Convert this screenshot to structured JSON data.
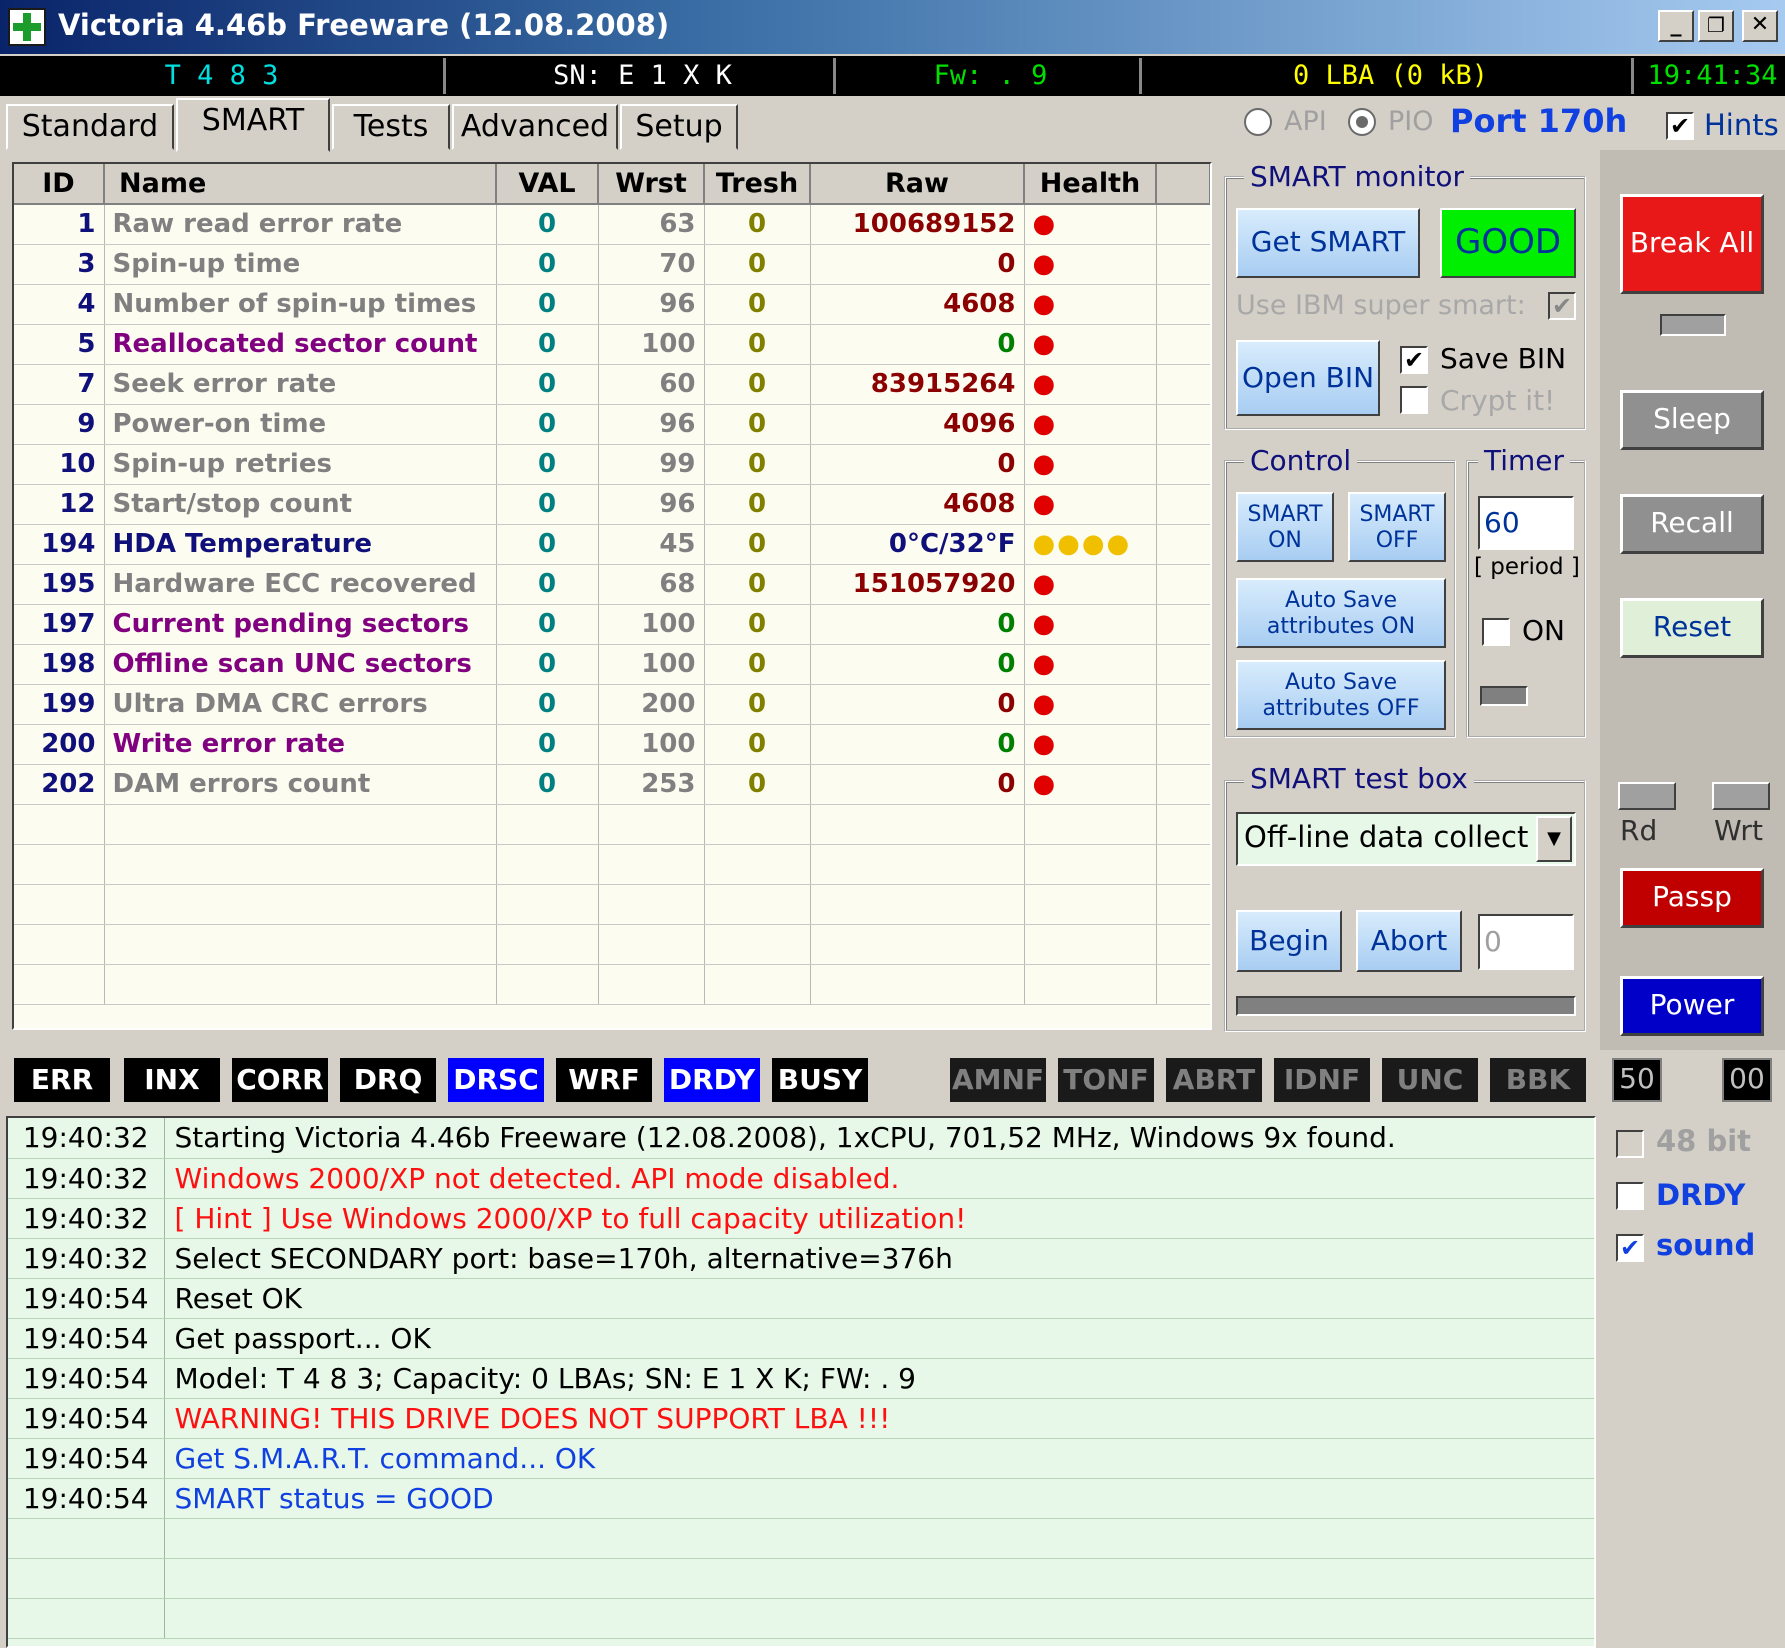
{
  "window": {
    "title": "Victoria 4.46b Freeware (12.08.2008)",
    "controls": {
      "minimize": "_",
      "restore": "❐",
      "close": "✕"
    }
  },
  "status": {
    "model": "T 4 8 3",
    "serial": "SN: E 1 X K",
    "firmware": "Fw: . 9",
    "lba": "0 LBA (0 kB)",
    "clock": "19:41:34"
  },
  "tabs": [
    {
      "label": "Standard"
    },
    {
      "label": "SMART"
    },
    {
      "label": "Tests"
    },
    {
      "label": "Advanced"
    },
    {
      "label": "Setup"
    }
  ],
  "port": {
    "api_label": "API",
    "pio_label": "PIO",
    "port_text": "Port 170h",
    "hints_label": "Hints",
    "hints_checked": true
  },
  "smart_table": {
    "columns": [
      "ID",
      "Name",
      "VAL",
      "Wrst",
      "Tresh",
      "Raw",
      "Health"
    ],
    "rows": [
      {
        "id": "1",
        "name": "Raw read error rate",
        "val": "0",
        "wrst": "63",
        "tresh": "0",
        "raw": "100689152",
        "health": "●",
        "style": "normal"
      },
      {
        "id": "3",
        "name": "Spin-up time",
        "val": "0",
        "wrst": "70",
        "tresh": "0",
        "raw": "0",
        "health": "●",
        "style": "normal"
      },
      {
        "id": "4",
        "name": "Number of spin-up times",
        "val": "0",
        "wrst": "96",
        "tresh": "0",
        "raw": "4608",
        "health": "●",
        "style": "normal"
      },
      {
        "id": "5",
        "name": "Reallocated sector count",
        "val": "0",
        "wrst": "100",
        "tresh": "0",
        "raw": "0",
        "health": "●",
        "style": "warn"
      },
      {
        "id": "7",
        "name": "Seek error rate",
        "val": "0",
        "wrst": "60",
        "tresh": "0",
        "raw": "83915264",
        "health": "●",
        "style": "normal"
      },
      {
        "id": "9",
        "name": "Power-on time",
        "val": "0",
        "wrst": "96",
        "tresh": "0",
        "raw": "4096",
        "health": "●",
        "style": "normal"
      },
      {
        "id": "10",
        "name": "Spin-up retries",
        "val": "0",
        "wrst": "99",
        "tresh": "0",
        "raw": "0",
        "health": "●",
        "style": "normal"
      },
      {
        "id": "12",
        "name": "Start/stop count",
        "val": "0",
        "wrst": "96",
        "tresh": "0",
        "raw": "4608",
        "health": "●",
        "style": "normal"
      },
      {
        "id": "194",
        "name": "HDA Temperature",
        "val": "0",
        "wrst": "45",
        "tresh": "0",
        "raw": "0°C/32°F",
        "health": "●●●●",
        "style": "temp"
      },
      {
        "id": "195",
        "name": "Hardware ECC recovered",
        "val": "0",
        "wrst": "68",
        "tresh": "0",
        "raw": "151057920",
        "health": "●",
        "style": "normal"
      },
      {
        "id": "197",
        "name": "Current pending sectors",
        "val": "0",
        "wrst": "100",
        "tresh": "0",
        "raw": "0",
        "health": "●",
        "style": "warn"
      },
      {
        "id": "198",
        "name": "Offline scan UNC sectors",
        "val": "0",
        "wrst": "100",
        "tresh": "0",
        "raw": "0",
        "health": "●",
        "style": "warn"
      },
      {
        "id": "199",
        "name": "Ultra DMA CRC errors",
        "val": "0",
        "wrst": "200",
        "tresh": "0",
        "raw": "0",
        "health": "●",
        "style": "normal"
      },
      {
        "id": "200",
        "name": "Write error rate",
        "val": "0",
        "wrst": "100",
        "tresh": "0",
        "raw": "0",
        "health": "●",
        "style": "warn"
      },
      {
        "id": "202",
        "name": "DAM errors count",
        "val": "0",
        "wrst": "253",
        "tresh": "0",
        "raw": "0",
        "health": "●",
        "style": "normal"
      }
    ]
  },
  "smart_monitor": {
    "title": "SMART monitor",
    "get_smart": "Get SMART",
    "status": "GOOD",
    "ibm_label": "Use IBM super smart:",
    "open_bin": "Open BIN",
    "save_bin": "Save BIN",
    "crypt": "Crypt it!"
  },
  "control": {
    "title": "Control",
    "smart_on": "SMART ON",
    "smart_off": "SMART OFF",
    "autosave_on": "Auto Save attributes ON",
    "autosave_off": "Auto Save attributes OFF"
  },
  "timer": {
    "title": "Timer",
    "value": "60",
    "period": "[ period ]",
    "on_label": "ON"
  },
  "test_box": {
    "title": "SMART test box",
    "selected": "Off-line data collect",
    "begin": "Begin",
    "abort": "Abort",
    "counter": "0"
  },
  "right_panel": {
    "break_all": "Break All",
    "sleep": "Sleep",
    "recall": "Recall",
    "reset": "Reset",
    "rd": "Rd",
    "wrt": "Wrt",
    "passp": "Passp",
    "power": "Power",
    "colors": {
      "break": "#e81818",
      "passp": "#c00000",
      "power": "#0000c8",
      "good": "#00ee00"
    }
  },
  "flags": {
    "left": [
      "ERR",
      "INX",
      "CORR",
      "DRQ",
      "DRSC",
      "WRF",
      "DRDY",
      "BUSY"
    ],
    "right": [
      "AMNF",
      "TONF",
      "ABRT",
      "IDNF",
      "UNC",
      "BBK"
    ],
    "counter_a": "50",
    "counter_b": "00"
  },
  "log": [
    {
      "time": "19:40:32",
      "text": "Starting Victoria 4.46b Freeware (12.08.2008), 1xCPU, 701,52 MHz, Windows 9x found.",
      "level": "normal"
    },
    {
      "time": "19:40:32",
      "text": "Windows 2000/XP not detected. API mode disabled.",
      "level": "error"
    },
    {
      "time": "19:40:32",
      "text": "[ Hint ] Use Windows 2000/XP to full capacity utilization!",
      "level": "error"
    },
    {
      "time": "19:40:32",
      "text": "Select SECONDARY port: base=170h, alternative=376h",
      "level": "normal"
    },
    {
      "time": "19:40:54",
      "text": "Reset OK",
      "level": "normal"
    },
    {
      "time": "19:40:54",
      "text": "Get passport... OK",
      "level": "normal"
    },
    {
      "time": "19:40:54",
      "text": "Model: T 4 8 3; Capacity: 0 LBAs; SN: E 1 X K; FW: . 9",
      "level": "normal"
    },
    {
      "time": "19:40:54",
      "text": "WARNING! THIS DRIVE DOES NOT SUPPORT LBA !!!",
      "level": "error"
    },
    {
      "time": "19:40:54",
      "text": "Get S.M.A.R.T. command... OK",
      "level": "info"
    },
    {
      "time": "19:40:54",
      "text": "SMART status = GOOD",
      "level": "info"
    }
  ],
  "options": {
    "bit48": "48 bit",
    "drdy": "DRDY",
    "sound": "sound",
    "sound_checked": true
  }
}
